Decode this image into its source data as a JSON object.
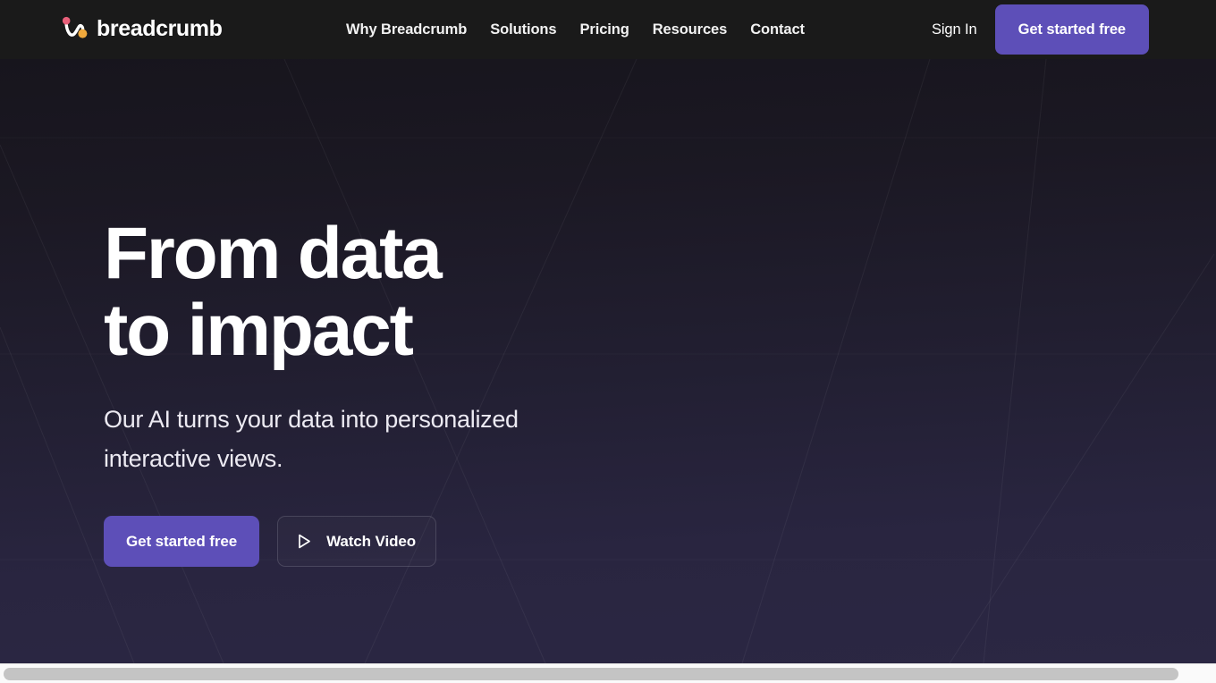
{
  "brand": {
    "name": "breadcrumb",
    "logo_icon": "breadcrumb-wave-logo",
    "dot_top_color": "#e8607a",
    "dot_bottom_color": "#f0a93c",
    "wave_color": "#ffffff"
  },
  "header": {
    "background": "#1a1a1a",
    "nav_items": [
      {
        "label": "Why Breadcrumb",
        "name": "why-breadcrumb"
      },
      {
        "label": "Solutions",
        "name": "solutions"
      },
      {
        "label": "Pricing",
        "name": "pricing"
      },
      {
        "label": "Resources",
        "name": "resources"
      },
      {
        "label": "Contact",
        "name": "contact"
      }
    ],
    "sign_in_label": "Sign In",
    "cta_label": "Get started free",
    "cta_color": "#5d4fb8"
  },
  "hero": {
    "headline": "From data\nto impact",
    "subhead": "Our AI turns your data into personalized interactive views.",
    "primary_cta_label": "Get started free",
    "secondary_cta_label": "Watch Video",
    "secondary_cta_icon": "play-icon",
    "gradient_top": "#17151d",
    "gradient_bottom": "#2b2743"
  },
  "scrollbar": {
    "orientation": "horizontal",
    "thumb_color": "#c4c4c4",
    "track_color": "#fafafa"
  }
}
